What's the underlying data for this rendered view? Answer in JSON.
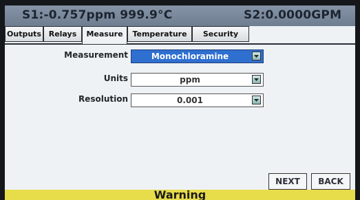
{
  "status": {
    "s1": "S1:-0.757ppm 999.9°C",
    "s2": "S2:0.0000GPM"
  },
  "tabs": [
    {
      "label": "Outputs"
    },
    {
      "label": "Relays"
    },
    {
      "label": "Measure"
    },
    {
      "label": "Temperature"
    },
    {
      "label": "Security"
    }
  ],
  "active_tab": "Measure",
  "form": {
    "measurement": {
      "label": "Measurement",
      "value": "Monochloramine"
    },
    "units": {
      "label": "Units",
      "value": "ppm"
    },
    "resolution": {
      "label": "Resolution",
      "value": "0.001"
    }
  },
  "buttons": {
    "next": "NEXT",
    "back": "BACK"
  },
  "warning": "Warning",
  "colors": {
    "status_bar": "#7b8a9d",
    "selected_field": "#2f6fd0",
    "warning_bar": "#e7dc4a"
  }
}
